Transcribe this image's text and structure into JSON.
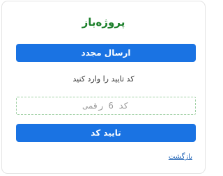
{
  "brand": {
    "logo_text": "پروژه‌باز",
    "color": "#1b7f2a"
  },
  "actions": {
    "resend_label": "ارسال مجدد",
    "confirm_label": "تایید کد",
    "back_label": "بازگشت",
    "primary_color": "#1a73e3"
  },
  "verification": {
    "prompt": "کد تایید را وارد کنید",
    "code_placeholder": "کد 6 رقمی",
    "code_value": ""
  }
}
